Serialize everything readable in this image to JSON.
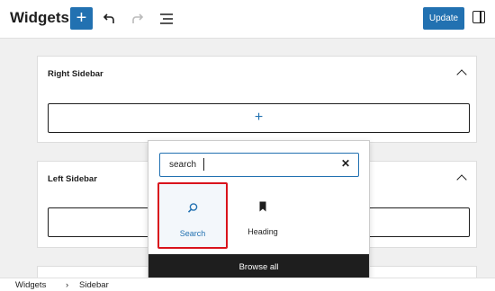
{
  "header": {
    "title": "Widgets",
    "add_icon": "plus-icon",
    "undo_icon": "undo-icon",
    "redo_icon": "redo-icon",
    "list_view_icon": "list-view-icon",
    "update_label": "Update",
    "settings_icon": "sidebar-toggle-icon"
  },
  "areas": [
    {
      "title": "Right Sidebar",
      "appender_label": "+"
    },
    {
      "title": "Left Sidebar"
    }
  ],
  "inserter": {
    "search_value": "search",
    "clear_label": "✕",
    "results": [
      {
        "label": "Search",
        "icon": "search-icon",
        "selected": true
      },
      {
        "label": "Heading",
        "icon": "bookmark-icon",
        "selected": false
      }
    ],
    "browse_all_label": "Browse all"
  },
  "breadcrumb": [
    "Widgets",
    "Sidebar"
  ],
  "breadcrumb_separator": "›",
  "colors": {
    "accent": "#2271b1",
    "highlight": "#d9131c",
    "dark": "#1e1e1e"
  }
}
